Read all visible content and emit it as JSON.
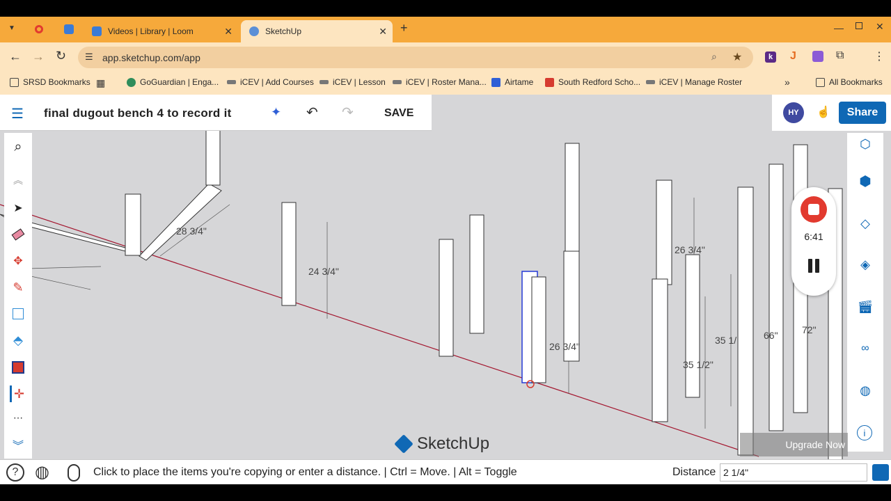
{
  "browser": {
    "tabs": [
      {
        "label": "Videos | Library | Loom",
        "active": false
      },
      {
        "label": "SketchUp",
        "active": true
      }
    ],
    "new_tab_icon": "plus-icon",
    "url": "app.sketchup.com/app",
    "bookmarks": [
      "SRSD Bookmarks",
      "GoGuardian | Enga...",
      "iCEV | Add Courses",
      "iCEV | Lesson",
      "iCEV | Roster Mana...",
      "Airtame",
      "South Redford Scho...",
      "iCEV | Manage Roster"
    ],
    "all_bookmarks": "All Bookmarks",
    "colors": {
      "tab_strip": "#f6a93b",
      "toolbar": "#fde5c0"
    }
  },
  "app": {
    "file_title": "final dugout bench 4 to record it",
    "save_label": "SAVE",
    "avatar_initials": "HY",
    "share_label": "Share",
    "brand": "SketchUp",
    "upgrade_label": "Upgrade Now",
    "recorder_time": "6:41",
    "status_text": "Click to place the items you're copying or enter a distance. | Ctrl = Move. | Alt = Toggle",
    "distance_label": "Distance",
    "distance_value": "2 1/4\"",
    "dimensions": [
      "28 3/4\"",
      "24 3/4\"",
      "26 3/4\"",
      "26 3/4\"",
      "35 1/",
      "66\"",
      "72\"",
      "35 1/2\""
    ],
    "left_tools": [
      "search-icon",
      "chevron-up-icon",
      "select-icon",
      "eraser-icon",
      "paint-icon",
      "pencil-icon",
      "line-icon",
      "push-pull-icon",
      "offset-icon",
      "move-icon",
      "more-icon",
      "chevron-down-icon"
    ],
    "right_tools": [
      "component-icon",
      "cube-icon",
      "tag-icon",
      "layers-icon",
      "scenes-icon",
      "glasses-icon",
      "globe-icon",
      "info-icon"
    ],
    "colors": {
      "share": "#0f68b5",
      "recorder": "#e23a2f",
      "canvas": "#d6d6d8",
      "red_axis": "#a3162f"
    }
  }
}
